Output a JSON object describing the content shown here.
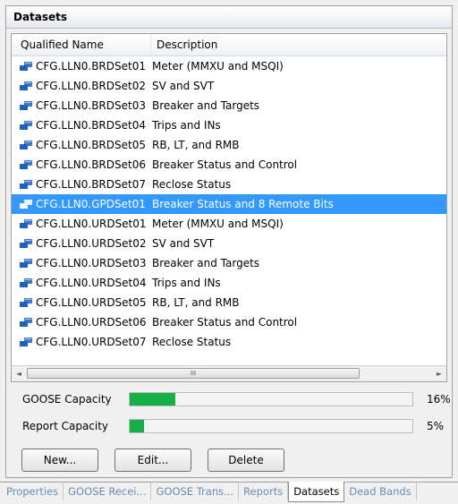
{
  "panel": {
    "title": "Datasets"
  },
  "grid": {
    "columns": [
      "Qualified Name",
      "Description"
    ],
    "rows": [
      {
        "name": "CFG.LLN0.BRDSet01",
        "description": "Meter (MMXU and MSQI)"
      },
      {
        "name": "CFG.LLN0.BRDSet02",
        "description": "SV and SVT"
      },
      {
        "name": "CFG.LLN0.BRDSet03",
        "description": "Breaker and  Targets"
      },
      {
        "name": "CFG.LLN0.BRDSet04",
        "description": "Trips and INs"
      },
      {
        "name": "CFG.LLN0.BRDSet05",
        "description": "RB, LT, and RMB"
      },
      {
        "name": "CFG.LLN0.BRDSet06",
        "description": "Breaker Status and Control"
      },
      {
        "name": "CFG.LLN0.BRDSet07",
        "description": "Reclose Status"
      },
      {
        "name": "CFG.LLN0.GPDSet01",
        "description": "Breaker Status and 8 Remote Bits"
      },
      {
        "name": "CFG.LLN0.URDSet01",
        "description": "Meter (MMXU and MSQI)"
      },
      {
        "name": "CFG.LLN0.URDSet02",
        "description": "SV and SVT"
      },
      {
        "name": "CFG.LLN0.URDSet03",
        "description": "Breaker and  Targets"
      },
      {
        "name": "CFG.LLN0.URDSet04",
        "description": "Trips and INs"
      },
      {
        "name": "CFG.LLN0.URDSet05",
        "description": "RB, LT, and RMB"
      },
      {
        "name": "CFG.LLN0.URDSet06",
        "description": "Breaker Status and Control"
      },
      {
        "name": "CFG.LLN0.URDSet07",
        "description": "Reclose Status"
      }
    ],
    "selected_index": 7,
    "scrollbar": {
      "left_arrow": "◄",
      "right_arrow": "►",
      "thumb_grip": "III"
    }
  },
  "capacity": {
    "goose": {
      "label": "GOOSE Capacity",
      "value_text": "16%",
      "fraction": 0.16
    },
    "report": {
      "label": "Report Capacity",
      "value_text": "5%",
      "fraction": 0.05
    }
  },
  "buttons": {
    "new": "New...",
    "edit": "Edit...",
    "delete": "Delete"
  },
  "tabs": [
    "Properties",
    "GOOSE Recei...",
    "GOOSE Trans...",
    "Reports",
    "Datasets",
    "Dead Bands"
  ],
  "active_tab_index": 4,
  "colors": {
    "selection": "#3399ff",
    "capacity_fill": "#14b046",
    "icon": "#1f5fbf"
  },
  "icons": {
    "dataset_row": "dataset-icon"
  }
}
